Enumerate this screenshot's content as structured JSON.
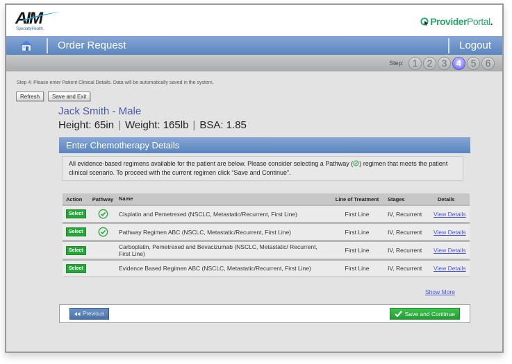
{
  "brand": {
    "logo_text": "AIM",
    "logo_subtitle": "SpecialtyHealth.",
    "portal_bold": "Provider",
    "portal_light": "Portal",
    "portal_dot": ".",
    "colors": {
      "portal_green": "#2aa86a",
      "nav_blue": "#5a86be"
    }
  },
  "nav": {
    "title": "Order Request",
    "logout_label": "Logout"
  },
  "steps": {
    "label": "Step:",
    "items": [
      "1",
      "2",
      "3",
      "4",
      "5",
      "6"
    ],
    "active": "4"
  },
  "instruction": "Step 4: Please enter Patient Clinical Details. Data will be automatically saved in the system.",
  "buttons": {
    "refresh": "Refresh",
    "save_exit": "Save and Exit",
    "previous": "Previous",
    "save_continue": "Save and Continue"
  },
  "patient": {
    "name_line": "Jack Smith - Male",
    "height": "Height: 65in",
    "weight": "Weight: 165lb",
    "bsa": "BSA: 1.85",
    "separator": "|"
  },
  "section": {
    "title": "Enter Chemotherapy Details",
    "notice_part1": "All evidence-based regimens available for the patient are below. Please consider selecting a Pathway (",
    "notice_part2": ") regimen that meets the patient clinical scenario. To proceed with the current regimen click “Save and Continue”."
  },
  "table": {
    "headers": {
      "action": "Action",
      "pathway": "Pathway",
      "name": "Name",
      "line_of_treatment": "Line of Treatment",
      "stages": "Stages",
      "details": "Details"
    },
    "rows": [
      {
        "action": "Select",
        "pathway": true,
        "name": "Cisplatin and Pemetrexed (NSCLC, Metastatic/Recurrent, First Line)",
        "line_of_treatment": "First Line",
        "stages": "IV, Recurrent",
        "details": "View Details"
      },
      {
        "action": "Select",
        "pathway": true,
        "name": "Pathway Regimen ABC (NSCLC, Metastatic/Recurrent, First Line)",
        "line_of_treatment": "First Line",
        "stages": "IV, Recurrent",
        "details": "View Details"
      },
      {
        "action": "Select",
        "pathway": false,
        "name": "Carboplatin, Pemetrexed and Bevacizumab (NSCLC, Metastatic/ Recurrent, First Line)",
        "line_of_treatment": "First Line",
        "stages": "IV, Recurrent",
        "details": "View Details"
      },
      {
        "action": "Select",
        "pathway": false,
        "name": "Evidence Based Regimen ABC (NSCLC, Metastatic/Recurrent, First Line)",
        "line_of_treatment": "First Line",
        "stages": "IV, Recurrent",
        "details": "View Details"
      }
    ],
    "show_more": "Show More"
  }
}
